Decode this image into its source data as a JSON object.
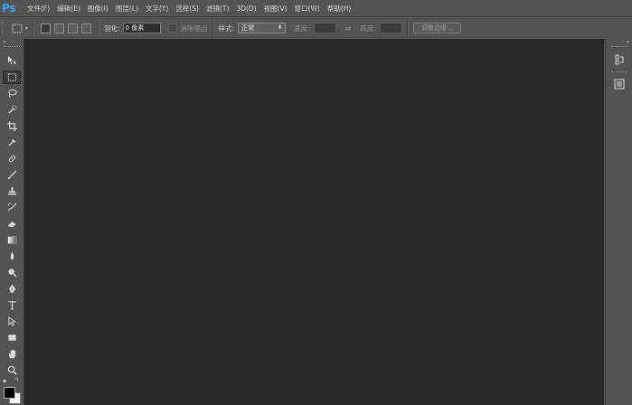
{
  "app": {
    "logo": "Ps"
  },
  "menu": [
    "文件(F)",
    "编辑(E)",
    "图像(I)",
    "图层(L)",
    "文字(Y)",
    "选择(S)",
    "滤镜(T)",
    "3D(D)",
    "视图(V)",
    "窗口(W)",
    "帮助(H)"
  ],
  "options": {
    "feather_label": "羽化:",
    "feather_value": "0 像素",
    "antialias_label": "消除锯齿",
    "style_label": "样式:",
    "style_value": "正常",
    "width_label": "宽度:",
    "height_label": "高度:",
    "refine_edge_label": "调整边缘..."
  },
  "tools": [
    "move-tool",
    "marquee-tool",
    "lasso-tool",
    "quick-selection-tool",
    "crop-tool",
    "eyedropper-tool",
    "spot-healing-tool",
    "brush-tool",
    "clone-stamp-tool",
    "history-brush-tool",
    "eraser-tool",
    "gradient-tool",
    "blur-tool",
    "dodge-tool",
    "pen-tool",
    "type-tool",
    "path-selection-tool",
    "rectangle-tool",
    "hand-tool",
    "zoom-tool"
  ],
  "colors": {
    "foreground": "#000000",
    "background": "#ffffff",
    "accent": "#31a8ff"
  },
  "right_dock": [
    "history-panel-icon",
    "properties-panel-icon"
  ]
}
